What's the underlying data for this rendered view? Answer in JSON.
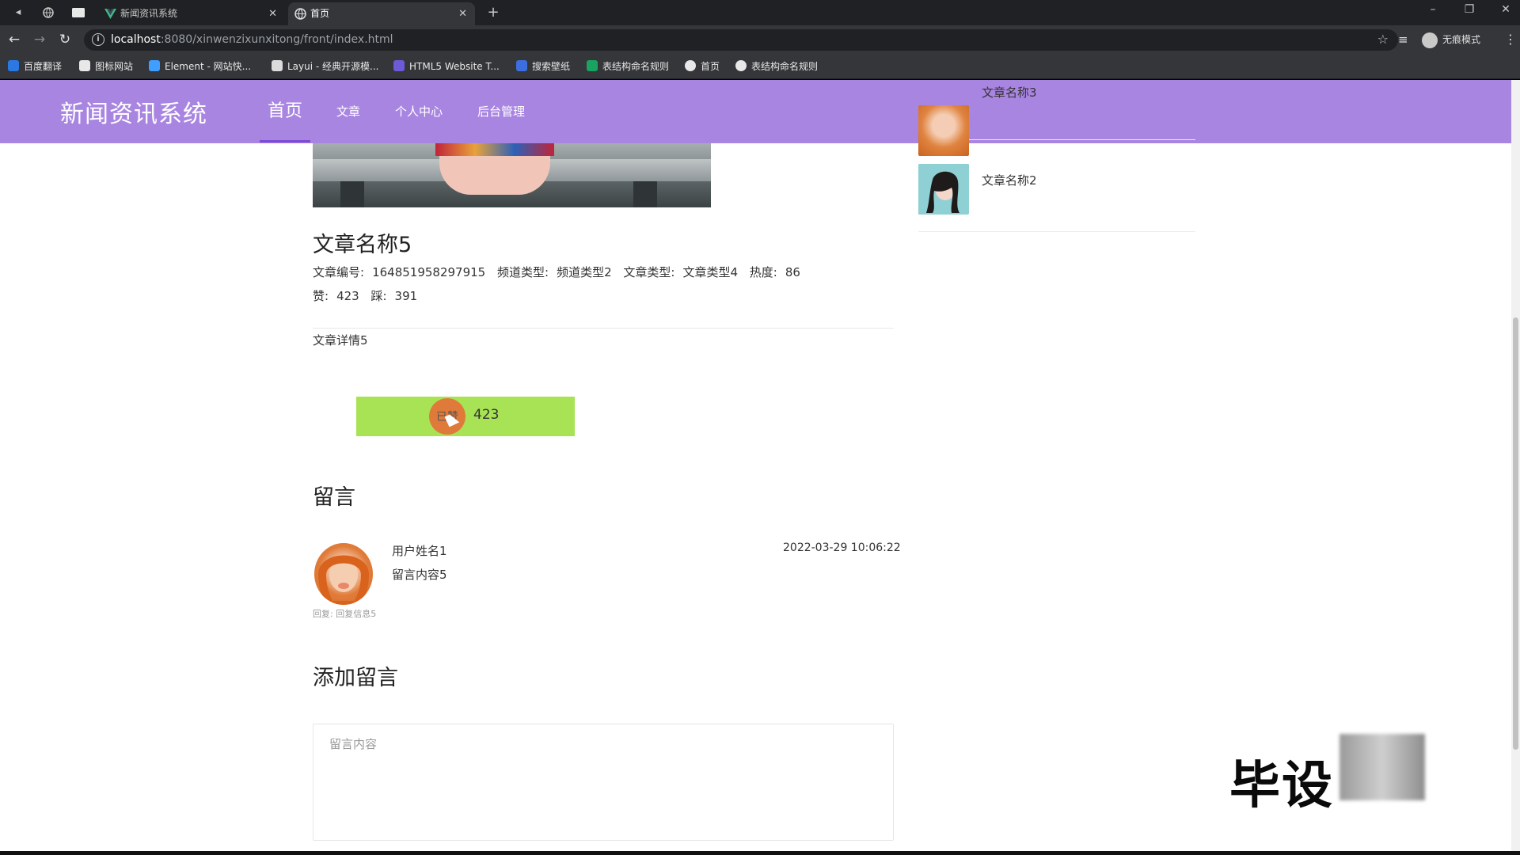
{
  "browser": {
    "tabs": [
      {
        "title": "新闻资讯系统",
        "active": false
      },
      {
        "title": "首页",
        "active": true
      }
    ],
    "url_host": "localhost",
    "url_rest": ":8080/xinwenzixunxitong/front/index.html",
    "profile_label": "无痕模式",
    "bookmarks": [
      "百度翻译",
      "图标网站",
      "Element - 网站快...",
      "Layui - 经典开源模...",
      "HTML5 Website T...",
      "搜索壁纸",
      "表结构命名规则",
      "首页",
      "表结构命名规则"
    ],
    "colors": {
      "tabbar": "#202124",
      "toolbar": "#35363a"
    }
  },
  "site": {
    "title": "新闻资讯系统",
    "nav": [
      "首页",
      "文章",
      "个人中心",
      "后台管理"
    ],
    "active_nav": "首页",
    "colors": {
      "header": "#a985e2",
      "like_button": "#a7e355",
      "underline": "#7c4bd8"
    }
  },
  "article": {
    "title": "文章名称5",
    "number_label": "文章编号:",
    "number": "164851958297915",
    "channel_label": "频道类型:",
    "channel": "频道类型2",
    "type_label": "文章类型:",
    "type": "文章类型4",
    "heat_label": "热度:",
    "heat": "86",
    "likes_label": "赞:",
    "likes": "423",
    "dislikes_label": "踩:",
    "dislikes": "391",
    "detail": "文章详情5"
  },
  "like_button": {
    "status": "已赞",
    "count": "423"
  },
  "comments": {
    "section_title": "留言",
    "items": [
      {
        "user": "用户姓名1",
        "time": "2022-03-29 10:06:22",
        "content": "留言内容5",
        "reply": "回复: 回复信息5"
      }
    ]
  },
  "add_comment": {
    "section_title": "添加留言",
    "placeholder": "留言内容"
  },
  "sidebar": {
    "items": [
      {
        "title": "文章名称3"
      },
      {
        "title": "文章名称2"
      }
    ]
  },
  "watermark": {
    "text": "毕设"
  }
}
